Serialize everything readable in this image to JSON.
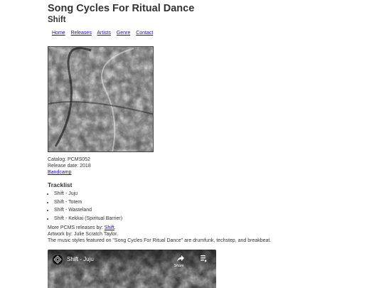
{
  "header": {
    "title": "Song Cycles For Ritual Dance",
    "subtitle": "Shift"
  },
  "nav": {
    "items": [
      "Home",
      "Releases",
      "Artists",
      "Genre",
      "Contact"
    ]
  },
  "cover": {
    "icon": "album-cover-image"
  },
  "meta": {
    "catalog": "Catalog: PCMS052",
    "release_date": "Release date: 2018",
    "bandcamp_link": "Bandcamp"
  },
  "tracklist": {
    "heading": "Tracklist",
    "tracks": [
      "Shift - Juju",
      "Shift - Totem",
      "Shift - Wasteland",
      "Shift - Kekkai (Spiritual Barrier)"
    ]
  },
  "more": {
    "releases_prefix": "More PCMS releases by: ",
    "releases_link": "Shift",
    "releases_suffix": ".",
    "artwork": "Artwork by: Julie Scratch Taylor.",
    "styles": "The music styles featured on \"Song Cycles For Ritual Dance\" are drumfunk, techstep, and breakbeat."
  },
  "video": {
    "title": "Shift - Juju",
    "share_label": "Share",
    "more_label": "",
    "logo_icon": "channel-logo-icon",
    "share_icon": "share-icon",
    "more_icon": "more-icon"
  }
}
